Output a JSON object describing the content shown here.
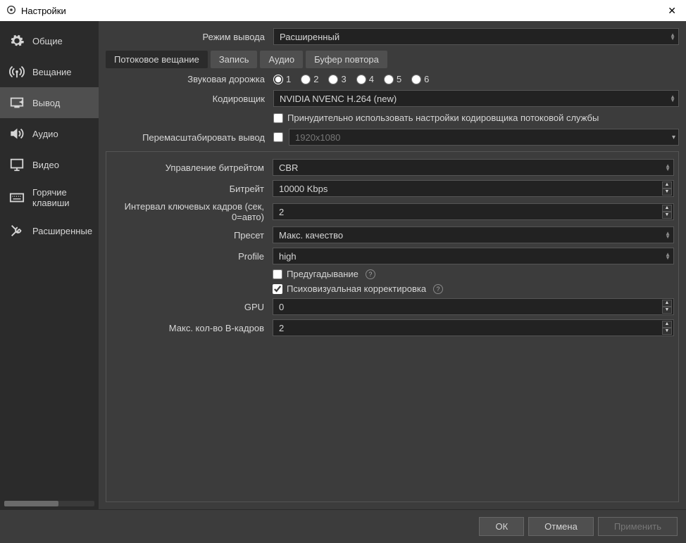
{
  "window": {
    "title": "Настройки"
  },
  "sidebar": {
    "items": [
      {
        "label": "Общие"
      },
      {
        "label": "Вещание"
      },
      {
        "label": "Вывод"
      },
      {
        "label": "Аудио"
      },
      {
        "label": "Видео"
      },
      {
        "label": "Горячие клавиши"
      },
      {
        "label": "Расширенные"
      }
    ]
  },
  "output_mode": {
    "label": "Режим вывода",
    "value": "Расширенный"
  },
  "tabs": [
    {
      "label": "Потоковое вещание"
    },
    {
      "label": "Запись"
    },
    {
      "label": "Аудио"
    },
    {
      "label": "Буфер повтора"
    }
  ],
  "audio_track": {
    "label": "Звуковая дорожка",
    "options": [
      "1",
      "2",
      "3",
      "4",
      "5",
      "6"
    ],
    "selected": "1"
  },
  "encoder": {
    "label": "Кодировщик",
    "value": "NVIDIA NVENC H.264 (new)"
  },
  "enforce": {
    "label": "Принудительно использовать настройки кодировщика потоковой службы",
    "checked": false
  },
  "rescale": {
    "label": "Перемасштабировать вывод",
    "checked": false,
    "value": "1920x1080"
  },
  "enc": {
    "rate_control": {
      "label": "Управление битрейтом",
      "value": "CBR"
    },
    "bitrate": {
      "label": "Битрейт",
      "value": "10000 Kbps"
    },
    "keyint": {
      "label": "Интервал ключевых кадров (сек, 0=авто)",
      "value": "2"
    },
    "preset": {
      "label": "Пресет",
      "value": "Макс. качество"
    },
    "profile": {
      "label": "Profile",
      "value": "high"
    },
    "lookahead": {
      "label": "Предугадывание",
      "checked": false
    },
    "psycho": {
      "label": "Психовизуальная корректировка",
      "checked": true
    },
    "gpu": {
      "label": "GPU",
      "value": "0"
    },
    "bframes": {
      "label": "Макс. кол-во B-кадров",
      "value": "2"
    }
  },
  "footer": {
    "ok": "ОК",
    "cancel": "Отмена",
    "apply": "Применить"
  }
}
